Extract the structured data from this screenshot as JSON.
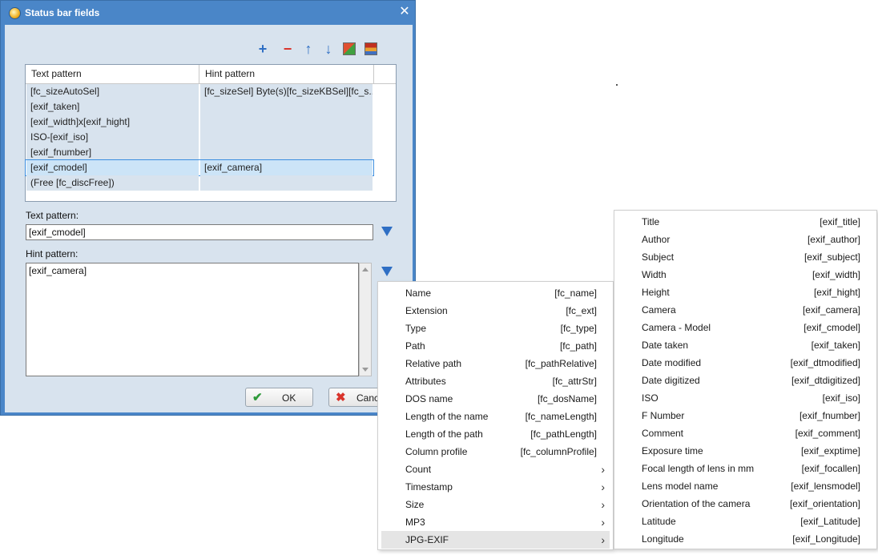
{
  "dialog": {
    "title": "Status bar fields",
    "toolbar": {
      "add_symbol": "+",
      "remove_symbol": "−",
      "up_symbol": "↑",
      "down_symbol": "↓"
    },
    "grid": {
      "columns": [
        "Text pattern",
        "Hint pattern"
      ],
      "rows": [
        {
          "text": "[fc_sizeAutoSel]",
          "hint": "[fc_sizeSel] Byte(s)[fc_sizeKBSel][fc_s..."
        },
        {
          "text": "[exif_taken]",
          "hint": ""
        },
        {
          "text": "[exif_width]x[exif_hight]",
          "hint": ""
        },
        {
          "text": "ISO-[exif_iso]",
          "hint": ""
        },
        {
          "text": "[exif_fnumber]",
          "hint": ""
        },
        {
          "text": "[exif_cmodel]",
          "hint": "[exif_camera]"
        },
        {
          "text": "(Free [fc_discFree])",
          "hint": ""
        }
      ],
      "selected_index": 5
    },
    "text_pattern_label": "Text pattern:",
    "text_pattern_value": "[exif_cmodel]",
    "hint_pattern_label": "Hint pattern:",
    "hint_pattern_value": "[exif_camera]",
    "ok_label": "OK",
    "cancel_label": "Canc"
  },
  "menu_left": {
    "items": [
      {
        "label": "Name",
        "value": "[fc_name]"
      },
      {
        "label": "Extension",
        "value": "[fc_ext]"
      },
      {
        "label": "Type",
        "value": "[fc_type]"
      },
      {
        "label": "Path",
        "value": "[fc_path]"
      },
      {
        "label": "Relative path",
        "value": "[fc_pathRelative]"
      },
      {
        "label": "Attributes",
        "value": "[fc_attrStr]"
      },
      {
        "label": "DOS name",
        "value": "[fc_dosName]"
      },
      {
        "label": "Length of the name",
        "value": "[fc_nameLength]"
      },
      {
        "label": "Length of the path",
        "value": "[fc_pathLength]"
      },
      {
        "label": "Column profile",
        "value": "[fc_columnProfile]"
      },
      {
        "label": "Count",
        "value": "›"
      },
      {
        "label": "Timestamp",
        "value": "›"
      },
      {
        "label": "Size",
        "value": "›"
      },
      {
        "label": "MP3",
        "value": "›"
      },
      {
        "label": "JPG-EXIF",
        "value": "›"
      }
    ]
  },
  "menu_right": {
    "items": [
      {
        "label": "Title",
        "value": "[exif_title]"
      },
      {
        "label": "Author",
        "value": "[exif_author]"
      },
      {
        "label": "Subject",
        "value": "[exif_subject]"
      },
      {
        "label": "Width",
        "value": "[exif_width]"
      },
      {
        "label": "Height",
        "value": "[exif_hight]"
      },
      {
        "label": "Camera",
        "value": "[exif_camera]"
      },
      {
        "label": "Camera - Model",
        "value": "[exif_cmodel]"
      },
      {
        "label": "Date taken",
        "value": "[exif_taken]"
      },
      {
        "label": "Date modified",
        "value": "[exif_dtmodified]"
      },
      {
        "label": "Date digitized",
        "value": "[exif_dtdigitized]"
      },
      {
        "label": "ISO",
        "value": "[exif_iso]"
      },
      {
        "label": "F Number",
        "value": "[exif_fnumber]"
      },
      {
        "label": "Comment",
        "value": "[exif_comment]"
      },
      {
        "label": "Exposure time",
        "value": "[exif_exptime]"
      },
      {
        "label": "Focal length of lens in mm",
        "value": "[exif_focallen]"
      },
      {
        "label": "Lens model name",
        "value": "[exif_lensmodel]"
      },
      {
        "label": "Orientation of the camera",
        "value": "[exif_orientation]"
      },
      {
        "label": "Latitude",
        "value": "[exif_Latitude]"
      },
      {
        "label": "Longitude",
        "value": "[exif_Longitude]"
      }
    ]
  },
  "colors": {
    "accent": "#2f6fc4",
    "titlebar": "#4a86c8",
    "client_bg": "#d8e3ee",
    "selection": "#cce4f7",
    "remove": "#d9342b"
  }
}
